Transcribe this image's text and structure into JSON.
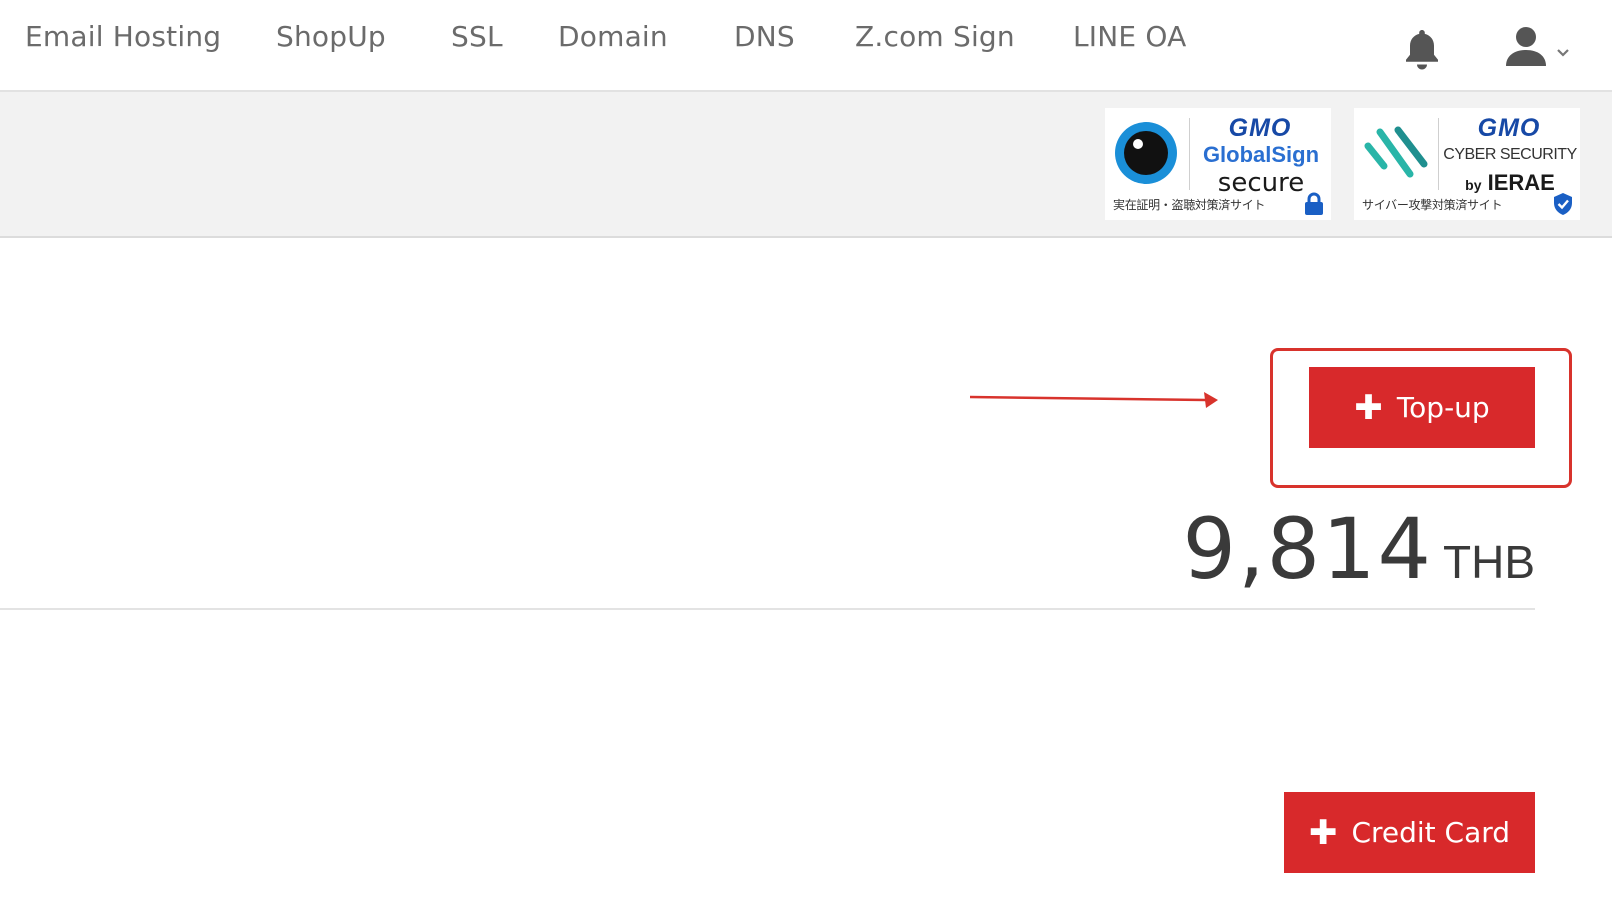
{
  "nav": {
    "items": [
      {
        "label": "Email Hosting"
      },
      {
        "label": "ShopUp"
      },
      {
        "label": "SSL"
      },
      {
        "label": "Domain"
      },
      {
        "label": "DNS"
      },
      {
        "label": "Z.com Sign"
      },
      {
        "label": "LINE OA"
      }
    ],
    "notification_icon": "bell-icon",
    "user_icon": "user-icon",
    "user_menu_icon": "chevron-down-icon"
  },
  "seals": {
    "globalsign": {
      "brand": "GMO",
      "line2": "GlobalSign",
      "line3": "secure",
      "caption": "実在証明・盗聴対策済サイト",
      "icon": "lock-icon"
    },
    "cyber": {
      "brand": "GMO",
      "line2": "CYBER SECURITY",
      "by": "by",
      "line3": "IERAE",
      "caption": "サイバー攻撃対策済サイト",
      "icon": "shield-check-icon"
    }
  },
  "wallet": {
    "topup_label": "Top-up",
    "amount": "9,814",
    "currency": "THB",
    "credit_card_label": "Credit Card"
  },
  "colors": {
    "accent_red": "#d8292b",
    "annotation_red": "#d8332c",
    "brand_blue": "#1749a6"
  }
}
